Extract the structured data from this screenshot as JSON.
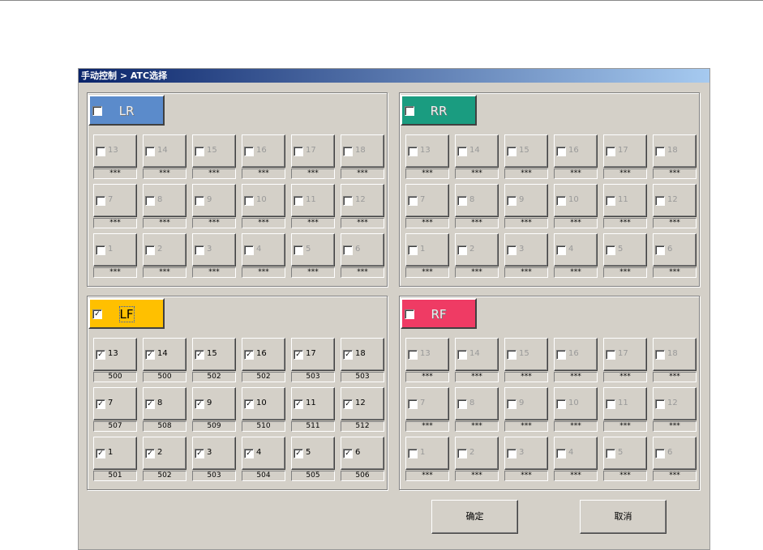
{
  "window": {
    "title": "手动控制 > ATC选择"
  },
  "groups": [
    {
      "key": "lr",
      "label": "LR",
      "checked": false,
      "color": "#5b8bcb",
      "cells": [
        {
          "num": "13",
          "checked": false,
          "value": "***"
        },
        {
          "num": "14",
          "checked": false,
          "value": "***"
        },
        {
          "num": "15",
          "checked": false,
          "value": "***"
        },
        {
          "num": "16",
          "checked": false,
          "value": "***"
        },
        {
          "num": "17",
          "checked": false,
          "value": "***"
        },
        {
          "num": "18",
          "checked": false,
          "value": "***"
        },
        {
          "num": "7",
          "checked": false,
          "value": "***"
        },
        {
          "num": "8",
          "checked": false,
          "value": "***"
        },
        {
          "num": "9",
          "checked": false,
          "value": "***"
        },
        {
          "num": "10",
          "checked": false,
          "value": "***"
        },
        {
          "num": "11",
          "checked": false,
          "value": "***"
        },
        {
          "num": "12",
          "checked": false,
          "value": "***"
        },
        {
          "num": "1",
          "checked": false,
          "value": "***"
        },
        {
          "num": "2",
          "checked": false,
          "value": "***"
        },
        {
          "num": "3",
          "checked": false,
          "value": "***"
        },
        {
          "num": "4",
          "checked": false,
          "value": "***"
        },
        {
          "num": "5",
          "checked": false,
          "value": "***"
        },
        {
          "num": "6",
          "checked": false,
          "value": "***"
        }
      ]
    },
    {
      "key": "rr",
      "label": "RR",
      "checked": false,
      "color": "#1a9c80",
      "cells": [
        {
          "num": "13",
          "checked": false,
          "value": "***"
        },
        {
          "num": "14",
          "checked": false,
          "value": "***"
        },
        {
          "num": "15",
          "checked": false,
          "value": "***"
        },
        {
          "num": "16",
          "checked": false,
          "value": "***"
        },
        {
          "num": "17",
          "checked": false,
          "value": "***"
        },
        {
          "num": "18",
          "checked": false,
          "value": "***"
        },
        {
          "num": "7",
          "checked": false,
          "value": "***"
        },
        {
          "num": "8",
          "checked": false,
          "value": "***"
        },
        {
          "num": "9",
          "checked": false,
          "value": "***"
        },
        {
          "num": "10",
          "checked": false,
          "value": "***"
        },
        {
          "num": "11",
          "checked": false,
          "value": "***"
        },
        {
          "num": "12",
          "checked": false,
          "value": "***"
        },
        {
          "num": "1",
          "checked": false,
          "value": "***"
        },
        {
          "num": "2",
          "checked": false,
          "value": "***"
        },
        {
          "num": "3",
          "checked": false,
          "value": "***"
        },
        {
          "num": "4",
          "checked": false,
          "value": "***"
        },
        {
          "num": "5",
          "checked": false,
          "value": "***"
        },
        {
          "num": "6",
          "checked": false,
          "value": "***"
        }
      ]
    },
    {
      "key": "lf",
      "label": "LF",
      "checked": true,
      "color": "#ffc000",
      "cells": [
        {
          "num": "13",
          "checked": true,
          "value": "500"
        },
        {
          "num": "14",
          "checked": true,
          "value": "500"
        },
        {
          "num": "15",
          "checked": true,
          "value": "502"
        },
        {
          "num": "16",
          "checked": true,
          "value": "502"
        },
        {
          "num": "17",
          "checked": true,
          "value": "503"
        },
        {
          "num": "18",
          "checked": true,
          "value": "503"
        },
        {
          "num": "7",
          "checked": true,
          "value": "507"
        },
        {
          "num": "8",
          "checked": true,
          "value": "508"
        },
        {
          "num": "9",
          "checked": true,
          "value": "509"
        },
        {
          "num": "10",
          "checked": true,
          "value": "510"
        },
        {
          "num": "11",
          "checked": true,
          "value": "511"
        },
        {
          "num": "12",
          "checked": true,
          "value": "512"
        },
        {
          "num": "1",
          "checked": true,
          "value": "501"
        },
        {
          "num": "2",
          "checked": true,
          "value": "502"
        },
        {
          "num": "3",
          "checked": true,
          "value": "503"
        },
        {
          "num": "4",
          "checked": true,
          "value": "504"
        },
        {
          "num": "5",
          "checked": true,
          "value": "505"
        },
        {
          "num": "6",
          "checked": true,
          "value": "506"
        }
      ]
    },
    {
      "key": "rf",
      "label": "RF",
      "checked": false,
      "color": "#ef3b64",
      "cells": [
        {
          "num": "13",
          "checked": false,
          "value": "***"
        },
        {
          "num": "14",
          "checked": false,
          "value": "***"
        },
        {
          "num": "15",
          "checked": false,
          "value": "***"
        },
        {
          "num": "16",
          "checked": false,
          "value": "***"
        },
        {
          "num": "17",
          "checked": false,
          "value": "***"
        },
        {
          "num": "18",
          "checked": false,
          "value": "***"
        },
        {
          "num": "7",
          "checked": false,
          "value": "***"
        },
        {
          "num": "8",
          "checked": false,
          "value": "***"
        },
        {
          "num": "9",
          "checked": false,
          "value": "***"
        },
        {
          "num": "10",
          "checked": false,
          "value": "***"
        },
        {
          "num": "11",
          "checked": false,
          "value": "***"
        },
        {
          "num": "12",
          "checked": false,
          "value": "***"
        },
        {
          "num": "1",
          "checked": false,
          "value": "***"
        },
        {
          "num": "2",
          "checked": false,
          "value": "***"
        },
        {
          "num": "3",
          "checked": false,
          "value": "***"
        },
        {
          "num": "4",
          "checked": false,
          "value": "***"
        },
        {
          "num": "5",
          "checked": false,
          "value": "***"
        },
        {
          "num": "6",
          "checked": false,
          "value": "***"
        }
      ]
    }
  ],
  "buttons": {
    "ok": "确定",
    "cancel": "取消"
  }
}
